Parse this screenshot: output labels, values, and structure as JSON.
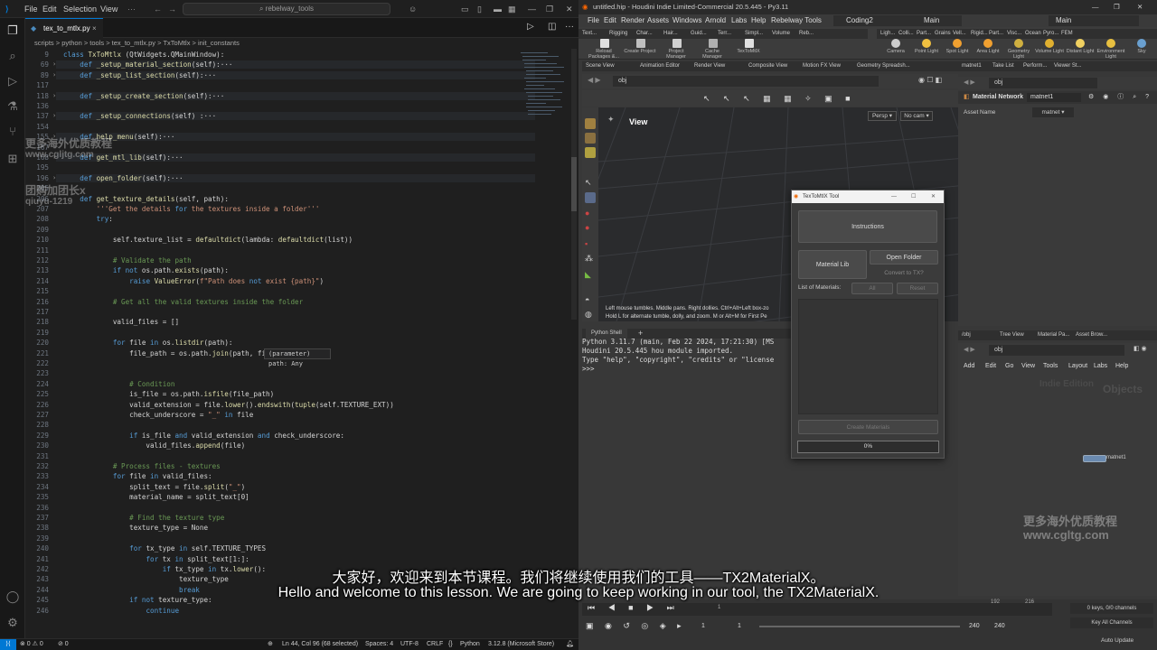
{
  "vscode": {
    "menu": [
      "File",
      "Edit",
      "Selection",
      "View"
    ],
    "search": "rebelway_tools",
    "tab": "tex_to_mtlx.py",
    "breadcrumb": "scripts > python > tools > tex_to_mtlx.py > TxToMtlx > init_constants",
    "lines": [
      {
        "n": "9",
        "t": "class TxToMtlx (QtWidgets.QMainWindow):",
        "f": false
      },
      {
        "n": "69",
        "t": "    def _setup_material_section(self):···",
        "f": true
      },
      {
        "n": "89",
        "t": "    def _setup_list_section(self):···",
        "f": true
      },
      {
        "n": "117",
        "t": "",
        "f": false
      },
      {
        "n": "118",
        "t": "    def _setup_create_section(self):···",
        "f": true
      },
      {
        "n": "136",
        "t": "",
        "f": false
      },
      {
        "n": "137",
        "t": "    def _setup_connections(self) :···",
        "f": true
      },
      {
        "n": "154",
        "t": "",
        "f": false
      },
      {
        "n": "155",
        "t": "    def help_menu(self):···",
        "f": true
      },
      {
        "n": "167",
        "t": "",
        "f": false
      },
      {
        "n": "168",
        "t": "    def get_mtl_lib(self):···",
        "f": true
      },
      {
        "n": "195",
        "t": "",
        "f": false
      },
      {
        "n": "196",
        "t": "    def open_folder(self):···",
        "f": true
      },
      {
        "n": "205",
        "t": "",
        "f": false
      },
      {
        "n": "206",
        "t": "    def get_texture_details(self, path):",
        "f": false
      },
      {
        "n": "207",
        "t": "        '''Get the details for the textures inside a folder'''",
        "f": false
      },
      {
        "n": "208",
        "t": "        try:",
        "f": false
      },
      {
        "n": "209",
        "t": "",
        "f": false
      },
      {
        "n": "210",
        "t": "            self.texture_list = defaultdict(lambda: defaultdict(list))",
        "f": false
      },
      {
        "n": "211",
        "t": "",
        "f": false
      },
      {
        "n": "212",
        "t": "            # Validate the path",
        "f": false
      },
      {
        "n": "213",
        "t": "            if not os.path.exists(path):",
        "f": false
      },
      {
        "n": "214",
        "t": "                raise ValueError(f\"Path does not exist {path}\")",
        "f": false
      },
      {
        "n": "215",
        "t": "",
        "f": false
      },
      {
        "n": "216",
        "t": "            # Get all the valid textures inside the folder",
        "f": false
      },
      {
        "n": "217",
        "t": "",
        "f": false
      },
      {
        "n": "218",
        "t": "            valid_files = []",
        "f": false
      },
      {
        "n": "219",
        "t": "",
        "f": false
      },
      {
        "n": "220",
        "t": "            for file in os.listdir(path):",
        "f": false
      },
      {
        "n": "221",
        "t": "                file_path = os.path.join(path, file)",
        "f": false
      },
      {
        "n": "222",
        "t": "",
        "f": false
      },
      {
        "n": "223",
        "t": "",
        "f": false
      },
      {
        "n": "224",
        "t": "                # Condition",
        "f": false
      },
      {
        "n": "225",
        "t": "                is_file = os.path.isfile(file_path)",
        "f": false
      },
      {
        "n": "226",
        "t": "                valid_extension = file.lower().endswith(tuple(self.TEXTURE_EXT))",
        "f": false
      },
      {
        "n": "227",
        "t": "                check_underscore = \"_\" in file",
        "f": false
      },
      {
        "n": "228",
        "t": "",
        "f": false
      },
      {
        "n": "229",
        "t": "                if is_file and valid_extension and check_underscore:",
        "f": false
      },
      {
        "n": "230",
        "t": "                    valid_files.append(file)",
        "f": false
      },
      {
        "n": "231",
        "t": "",
        "f": false
      },
      {
        "n": "232",
        "t": "            # Process files - textures",
        "f": false
      },
      {
        "n": "233",
        "t": "            for file in valid_files:",
        "f": false
      },
      {
        "n": "234",
        "t": "                split_text = file.split(\"_\")",
        "f": false
      },
      {
        "n": "235",
        "t": "                material_name = split_text[0]",
        "f": false
      },
      {
        "n": "236",
        "t": "",
        "f": false
      },
      {
        "n": "237",
        "t": "                # Find the texture type",
        "f": false
      },
      {
        "n": "238",
        "t": "                texture_type = None",
        "f": false
      },
      {
        "n": "239",
        "t": "",
        "f": false
      },
      {
        "n": "240",
        "t": "                for tx_type in self.TEXTURE_TYPES",
        "f": false
      },
      {
        "n": "241",
        "t": "                    for tx in split_text[1:]:",
        "f": false
      },
      {
        "n": "242",
        "t": "                        if tx_type in tx.lower():",
        "f": false
      },
      {
        "n": "243",
        "t": "                            texture_type",
        "f": false
      },
      {
        "n": "244",
        "t": "                            break",
        "f": false
      },
      {
        "n": "245",
        "t": "                if not texture_type:",
        "f": false
      },
      {
        "n": "246",
        "t": "                    continue",
        "f": false
      }
    ],
    "hover": "(parameter) path: Any",
    "status": {
      "errors": "⊗ 0 ⚠ 0",
      "ports": "⊘ 0",
      "position": "Ln 44, Col 96 (68 selected)",
      "spaces": "Spaces: 4",
      "encoding": "UTF-8",
      "eol": "CRLF",
      "lang": "Python",
      "interp": "3.12.8 (Microsoft Store)"
    }
  },
  "houdini": {
    "title": "untitled.hip - Houdini Indie Limited-Commercial 20.5.445 - Py3.11",
    "menu": [
      "File",
      "Edit",
      "Render",
      "Assets",
      "Windows",
      "Arnold",
      "Labs",
      "Help",
      "Rebelway Tools"
    ],
    "desktop": "Coding2",
    "desktop2": "Main",
    "desktop3": "Main",
    "shelf_tabs_left": [
      "Text...",
      "Rigging",
      "Char...",
      "Hair...",
      "Guid...",
      "Terr...",
      "Simpl...",
      "Volume",
      "Reb..."
    ],
    "shelf_tabs_right": [
      "Ligh...",
      "Colli...",
      "Part...",
      "Grains",
      "Vell...",
      "Rigid...",
      "Part...",
      "Visc...",
      "Ocean",
      "Pyro...",
      "FEM"
    ],
    "shelf_tools_left": [
      "Reload Packages &...",
      "Create Project",
      "Project Manager",
      "Cache Manager",
      "TexToMtlX"
    ],
    "shelf_tools_right": [
      "Camera",
      "Point Light",
      "Spot Light",
      "Area Light",
      "Geometry Light",
      "Volume Light",
      "Distant Light",
      "Environment Light",
      "Sky"
    ],
    "panel_tabs": [
      "Scene View",
      "Animation Editor",
      "Render View",
      "Composite View",
      "Motion FX View",
      "Geometry Spreadsh..."
    ],
    "path": "obj",
    "view_label": "View",
    "persp": "Persp",
    "cam": "No cam",
    "vp_help1": "Left mouse tumbles. Middle pans. Right dollies. Ctrl+Alt+Left box-zo",
    "vp_help2": "Hold L for alternate tumble, dolly, and zoom. M or Alt+M for First Pe",
    "shell_tab": "Python Shell",
    "shell_lines": [
      "Python 3.11.7 (main, Feb 22 2024, 17:21:30) [MS",
      "Houdini 20.5.445 hou module imported.",
      "Type \"help\", \"copyright\", \"credits\" or \"license",
      ">>>"
    ],
    "right_tabs": [
      "matnet1",
      "Take List",
      "Perform...",
      "Viewer St..."
    ],
    "mat_network": "Material Network",
    "mat_name": "matnet1",
    "asset_name": "Asset Name",
    "asset_value": "matnet",
    "net_tabs": [
      "/obj",
      "Tree View",
      "Material Pa...",
      "Asset Brow..."
    ],
    "net_menu": [
      "Add",
      "Edit",
      "Go",
      "View",
      "Tools",
      "Layout",
      "Labs",
      "Help"
    ],
    "net_watermark1": "Indie Edition",
    "net_watermark2": "Objects",
    "node_label": "matnet1",
    "timeline": {
      "frame": "1",
      "start": "1",
      "end": "240",
      "end2": "240",
      "t1": "192",
      "t2": "216",
      "keys": "0 keys, 0/0 channels",
      "keyall": "Key All Channels",
      "autoupdate": "Auto Update"
    }
  },
  "tool": {
    "title": "TexToMtlX Tool",
    "instructions": "Instructions",
    "material_lib": "Material Lib",
    "open_folder": "Open Folder",
    "convert": "Convert to TX?",
    "list_label": "List of Materials:",
    "all": "All",
    "reset": "Reset",
    "create": "Create Materials",
    "progress": 0,
    "progress_text": "0%"
  },
  "subtitles": {
    "zh": "大家好，欢迎来到本节课程。我们将继续使用我们的工具——TX2MaterialX。",
    "en": "Hello and welcome to this lesson. We are going to keep working in our tool, the TX2MaterialX."
  },
  "watermarks": {
    "left1": "更多海外优质教程",
    "left2": "www.cgljtg.com",
    "left3": "团购加团长x",
    "left4": "qiuyu-1219",
    "right1": "更多海外优质教程",
    "right2": "www.cgltg.com"
  },
  "colors": {
    "accent": "#0078d4",
    "keyword": "#569cd6",
    "func": "#dcdcaa",
    "string": "#ce9178",
    "comment": "#6a9955"
  }
}
